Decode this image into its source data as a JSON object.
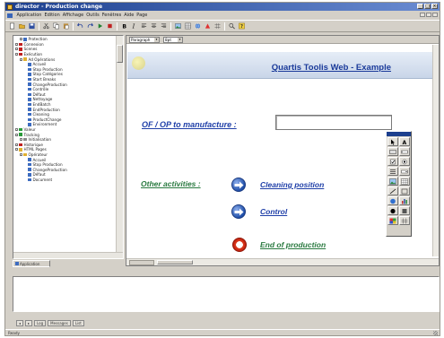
{
  "window": {
    "title": "director - Production change"
  },
  "menu": {
    "items": [
      "Application",
      "Edition",
      "Affichage",
      "Outils",
      "Fenêtres",
      "Aide",
      "Page"
    ]
  },
  "toolbar": {
    "buttons": [
      "new-icon",
      "open-icon",
      "save-icon",
      "cut-icon",
      "copy-icon",
      "paste-icon",
      "undo-icon",
      "redo-icon",
      "play-icon",
      "stop-icon",
      "bold-icon",
      "italic-icon",
      "align-left-icon",
      "align-center-icon",
      "align-right-icon",
      "image-icon",
      "table-icon",
      "link-icon",
      "color-icon",
      "grid-icon",
      "zoom-icon",
      "help-icon"
    ]
  },
  "tree": {
    "rows": [
      {
        "label": "Protection",
        "indent": 1,
        "icon": "page"
      },
      {
        "label": "Connexion",
        "indent": 0,
        "icon": "red"
      },
      {
        "label": "Scenes",
        "indent": 0,
        "icon": "red"
      },
      {
        "label": "Exécution",
        "indent": 0,
        "icon": "red"
      },
      {
        "label": "Ad Opérations",
        "indent": 1,
        "icon": "folder"
      },
      {
        "label": "Accueil",
        "indent": 2,
        "icon": "page"
      },
      {
        "label": "Stop Production",
        "indent": 2,
        "icon": "page"
      },
      {
        "label": "Stop Catégories",
        "indent": 2,
        "icon": "page"
      },
      {
        "label": "Start Breaks",
        "indent": 2,
        "icon": "page"
      },
      {
        "label": "ChangeProduction",
        "indent": 2,
        "icon": "page"
      },
      {
        "label": "Contrôle",
        "indent": 2,
        "icon": "page"
      },
      {
        "label": "Défaut",
        "indent": 2,
        "icon": "page"
      },
      {
        "label": "Nettoyage",
        "indent": 2,
        "icon": "page"
      },
      {
        "label": "EndBatch",
        "indent": 2,
        "icon": "page"
      },
      {
        "label": "EndProduction",
        "indent": 2,
        "icon": "page"
      },
      {
        "label": "Cleaning",
        "indent": 2,
        "icon": "page"
      },
      {
        "label": "ProductChange",
        "indent": 2,
        "icon": "page"
      },
      {
        "label": "Environment",
        "indent": 2,
        "icon": "page"
      },
      {
        "label": "Valeur",
        "indent": 0,
        "icon": "green"
      },
      {
        "label": "Tracking",
        "indent": 0,
        "icon": "green"
      },
      {
        "label": "Initialisation",
        "indent": 1,
        "icon": "grey"
      },
      {
        "label": "Historique",
        "indent": 0,
        "icon": "red"
      },
      {
        "label": "HTML Pages",
        "indent": 0,
        "icon": "folder"
      },
      {
        "label": "Opérateur",
        "indent": 1,
        "icon": "folder"
      },
      {
        "label": "Accueil",
        "indent": 2,
        "icon": "page"
      },
      {
        "label": "Stop Production",
        "indent": 2,
        "icon": "page"
      },
      {
        "label": "ChangeProduction",
        "indent": 2,
        "icon": "page"
      },
      {
        "label": "Défaut",
        "indent": 2,
        "icon": "page"
      },
      {
        "label": "Document",
        "indent": 2,
        "icon": "page"
      }
    ]
  },
  "left_tab": {
    "label": "Application"
  },
  "editor": {
    "style_select": "Paragraph",
    "font_select": "8pt",
    "banner_title": "Quartis Toolis Web - Example",
    "of_label": "OF / OP to manufacture :",
    "of_value": "",
    "other_label": "Other activities :",
    "actions": [
      {
        "label": "Cleaning position",
        "icon": "arrow-right-icon",
        "color": "blue"
      },
      {
        "label": "Control",
        "icon": "arrow-right-icon",
        "color": "blue"
      },
      {
        "label": "End of production",
        "icon": "lifebuoy-icon",
        "color": "green"
      }
    ]
  },
  "palette": {
    "tools": [
      "pointer-icon",
      "text-icon",
      "button-icon",
      "input-icon",
      "checkbox-icon",
      "radio-icon",
      "list-icon",
      "combo-icon",
      "image-icon",
      "table-icon",
      "line-icon",
      "frame-icon",
      "link-icon",
      "chart-icon",
      "circle-icon",
      "square-icon",
      "color-icon",
      "grid-icon"
    ]
  },
  "bottom_tabs": [
    "Log",
    "Messages",
    "List"
  ],
  "status": {
    "text": "Ready"
  },
  "colors": {
    "link_blue": "#1f3fa8",
    "link_green": "#2a7a40",
    "title_bar": "#1c3f8e"
  }
}
